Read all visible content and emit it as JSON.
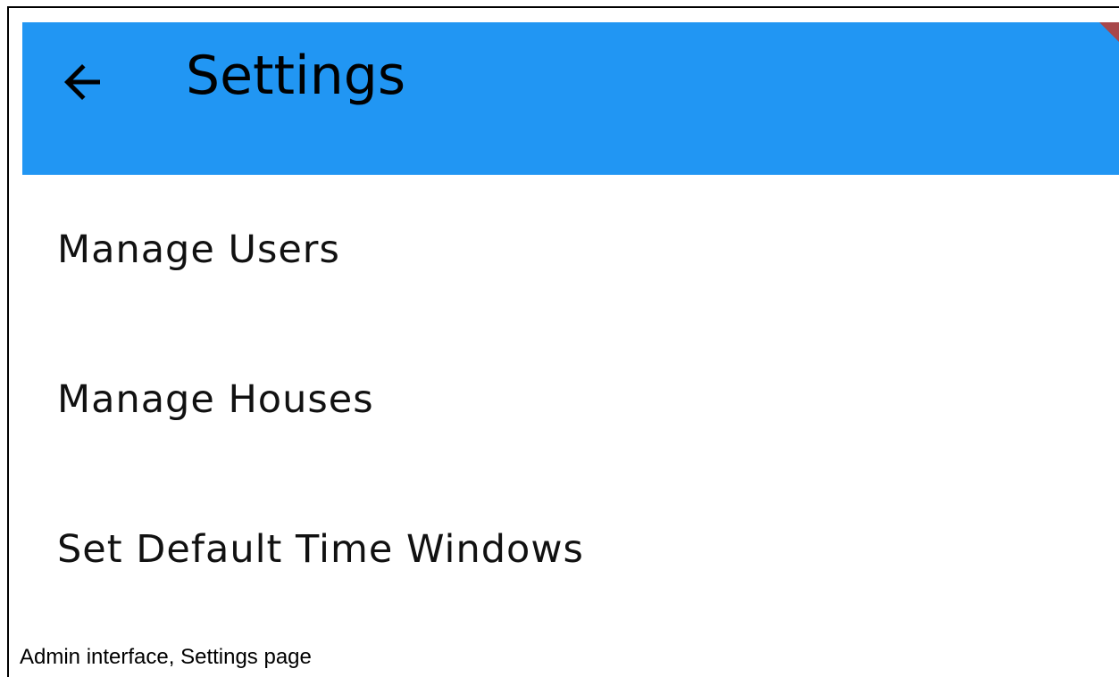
{
  "app_bar": {
    "title": "Settings",
    "back_icon": "arrow-back-icon",
    "color": "#2196F3"
  },
  "menu": {
    "items": [
      {
        "label": "Manage Users"
      },
      {
        "label": "Manage Houses"
      },
      {
        "label": "Set Default Time Windows"
      }
    ]
  },
  "caption": "Admin interface, Settings page"
}
